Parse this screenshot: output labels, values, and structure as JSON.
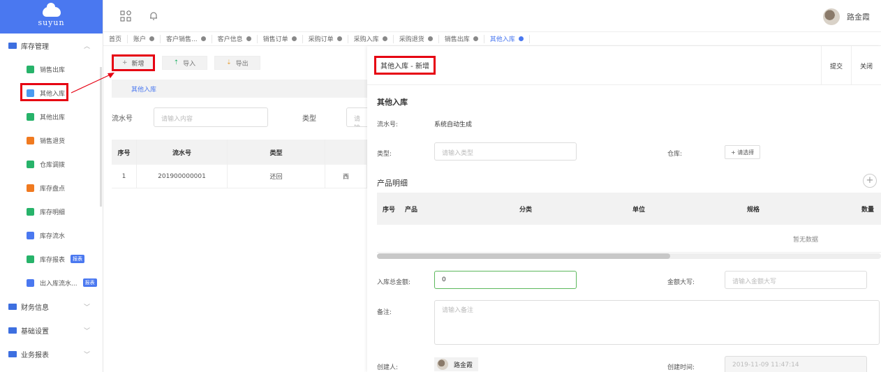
{
  "sidebar": {
    "brand": "suyun",
    "group_inventory": "库存管理",
    "items": [
      {
        "label": "销售出库",
        "color": "#27b36a",
        "badge": ""
      },
      {
        "label": "其他入库",
        "color": "#4a9bf0",
        "badge": ""
      },
      {
        "label": "其他出库",
        "color": "#27b36a",
        "badge": ""
      },
      {
        "label": "销售退货",
        "color": "#f07a20",
        "badge": ""
      },
      {
        "label": "仓库调拨",
        "color": "#27b36a",
        "badge": ""
      },
      {
        "label": "库存盘点",
        "color": "#f07a20",
        "badge": ""
      },
      {
        "label": "库存明细",
        "color": "#27b36a",
        "badge": ""
      },
      {
        "label": "库存流水",
        "color": "#4a78f0",
        "badge": ""
      },
      {
        "label": "库存报表",
        "color": "#27b36a",
        "badge": "报表"
      },
      {
        "label": "出入库流水...",
        "color": "#4a78f0",
        "badge": "报表"
      }
    ],
    "group_finance": "财务信息",
    "group_settings": "基础设置",
    "group_reports": "业务报表"
  },
  "header": {
    "user_name": "路金霞"
  },
  "tabs": [
    {
      "label": "首页",
      "closable": false
    },
    {
      "label": "账户",
      "closable": true
    },
    {
      "label": "客户销售...",
      "closable": true
    },
    {
      "label": "客户信息",
      "closable": true
    },
    {
      "label": "销售订单",
      "closable": true
    },
    {
      "label": "采购订单",
      "closable": true
    },
    {
      "label": "采购入库",
      "closable": true
    },
    {
      "label": "采购退货",
      "closable": true
    },
    {
      "label": "销售出库",
      "closable": true
    },
    {
      "label": "其他入库",
      "closable": true,
      "active": true
    }
  ],
  "list": {
    "btn_add": "新增",
    "btn_import": "导入",
    "btn_export": "导出",
    "subtab": "其他入库",
    "filter_serial_label": "流水号",
    "filter_serial_placeholder": "请输入内容",
    "filter_type_label": "类型",
    "filter_type_placeholder": "请输",
    "columns": [
      "序号",
      "流水号",
      "类型",
      ""
    ],
    "rows": [
      [
        "1",
        "201900000001",
        "还回",
        "西"
      ]
    ]
  },
  "form": {
    "title": "其他入库 - 新增",
    "submit": "提交",
    "close": "关闭",
    "section_title": "其他入库",
    "serial_label": "流水号:",
    "serial_value": "系统自动生成",
    "type_label": "类型:",
    "type_placeholder": "请输入类型",
    "warehouse_label": "仓库:",
    "warehouse_btn": "+ 请选择",
    "detail_title": "产品明细",
    "detail_columns": [
      "序号",
      "产品",
      "分类",
      "单位",
      "规格",
      "数量"
    ],
    "empty_text": "暂无数据",
    "total_label": "入库总金额:",
    "total_value": "0",
    "upper_label": "金额大写:",
    "upper_placeholder": "请输入金额大写",
    "remark_label": "备注:",
    "remark_placeholder": "请输入备注",
    "creator_label": "创建人:",
    "creator_name": "路金霞",
    "created_label": "创建时间:",
    "created_value": "2019-11-09 11:47:14"
  }
}
